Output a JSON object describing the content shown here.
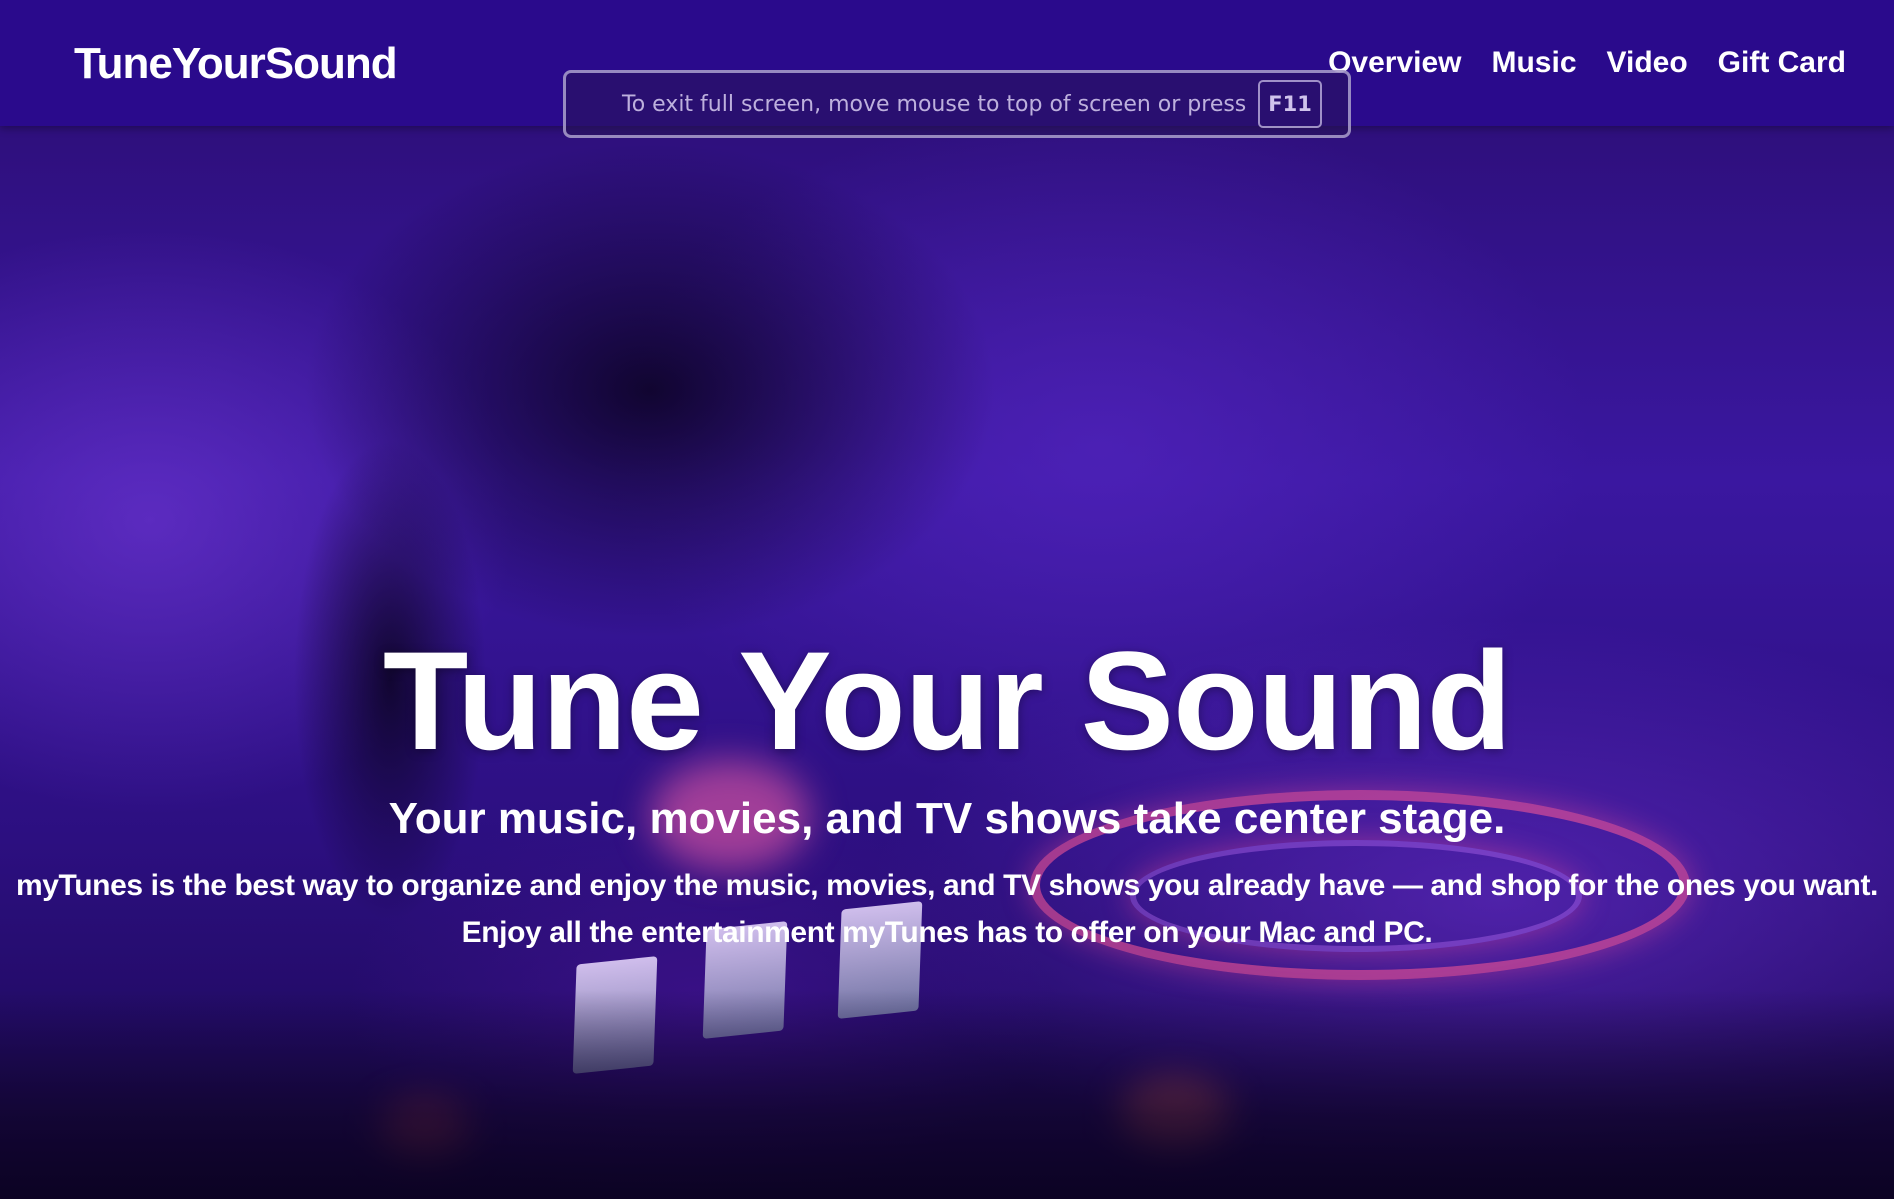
{
  "navbar": {
    "brand": "TuneYourSound",
    "links": [
      {
        "label": "Overview"
      },
      {
        "label": "Music"
      },
      {
        "label": "Video"
      },
      {
        "label": "Gift Card"
      }
    ]
  },
  "fullscreen_toast": {
    "message": "To exit full screen, move mouse to top of screen or press",
    "key": "F11"
  },
  "hero": {
    "title": "Tune Your Sound",
    "subtitle": "Your music, movies, and TV shows take center stage.",
    "body_line_1": "myTunes is the best way to organize and enjoy the music, movies, and TV shows you already have — and shop for the ones you want.",
    "body_line_2": "Enjoy all the entertainment myTunes has to offer on your Mac and PC."
  },
  "colors": {
    "navbar_bg": "#2a0a8c",
    "text": "#ffffff",
    "hero_tint": "#3a17a0"
  }
}
